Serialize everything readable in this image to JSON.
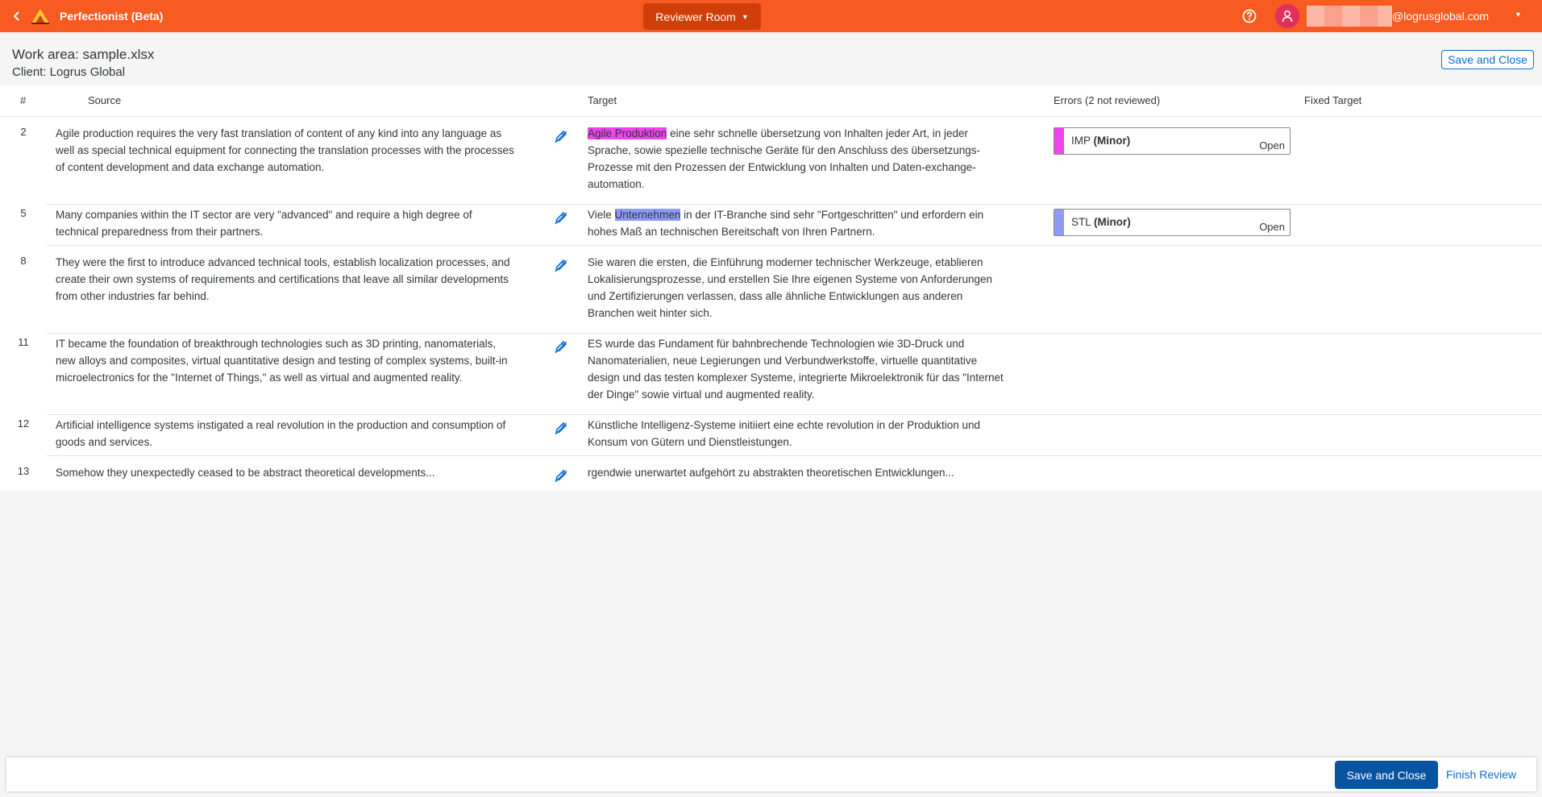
{
  "app": {
    "title": "Perfectionist (Beta)",
    "room_label": "Reviewer Room",
    "user_email": "@logrusglobal.com",
    "brand_color": "#f75b21"
  },
  "icons": {
    "back": "chevron-left-icon",
    "logo": "mountain-logo-icon",
    "help": "help-icon",
    "user": "user-icon",
    "edit": "edit-pen-icon"
  },
  "header": {
    "work_area": "Work area: sample.xlsx",
    "client": "Client: Logrus Global",
    "save_close_label": "Save and Close"
  },
  "table": {
    "columns": {
      "num": "#",
      "source": "Source",
      "target": "Target",
      "errors": "Errors (2 not reviewed)",
      "fixed_target": "Fixed Target"
    },
    "rows": [
      {
        "num": "2",
        "source": "Agile production requires the very fast translation of content of any kind into any language as well as special technical equipment for connecting the translation processes with the processes of content development and data exchange automation.",
        "target_pre": "",
        "target_hl": "Agile Produktion",
        "target_post": " eine sehr schnelle übersetzung von Inhalten jeder Art, in jeder Sprache, sowie spezielle technische Geräte für den Anschluss des übersetzungs-Prozesse mit den Prozessen der Entwicklung von Inhalten und Daten-exchange-automation.",
        "error": {
          "code": "IMP",
          "severity": "(Minor)",
          "status": "Open",
          "color": "#ee43ee"
        }
      },
      {
        "num": "5",
        "source": "Many companies within the IT sector are very \"advanced\" and require a high degree of technical preparedness from their partners.",
        "target_pre": "Viele ",
        "target_hl": "Unternehmen",
        "target_post": " in der IT-Branche sind sehr \"Fortgeschritten\" und erfordern ein hohes Maß an technischen Bereitschaft von Ihren Partnern.",
        "error": {
          "code": "STL",
          "severity": "(Minor)",
          "status": "Open",
          "color": "#8e9bf6"
        }
      },
      {
        "num": "8",
        "source": "They were the first to introduce advanced technical tools, establish localization processes, and create their own systems of requirements and certifications that leave all similar developments from other industries far behind.",
        "target": "Sie waren die ersten, die Einführung moderner technischer Werkzeuge, etablieren Lokalisierungsprozesse, und erstellen Sie Ihre eigenen Systeme von Anforderungen und Zertifizierungen verlassen, dass alle ähnliche Entwicklungen aus anderen Branchen weit hinter sich."
      },
      {
        "num": "11",
        "source": "IT became the foundation of breakthrough technologies such as 3D printing, nanomaterials, new alloys and composites, virtual quantitative design and testing of complex systems, built-in microelectronics for the \"Internet of Things,\" as well as virtual and augmented reality.",
        "target": "ES wurde das Fundament für bahnbrechende Technologien wie 3D-Druck und Nanomaterialien, neue Legierungen und Verbundwerkstoffe, virtuelle quantitative design und das testen komplexer Systeme, integrierte Mikroelektronik für das \"Internet der Dinge\" sowie virtual und augmented reality."
      },
      {
        "num": "12",
        "source": "Artificial intelligence systems instigated a real revolution in the production and consumption of goods and services.",
        "target": "Künstliche Intelligenz-Systeme initiiert eine echte revolution in der Produktion und Konsum von Gütern und Dienstleistungen."
      },
      {
        "num": "13",
        "source": "Somehow they unexpectedly ceased to be abstract theoretical developments...",
        "target": "rgendwie unerwartet aufgehört zu abstrakten theoretischen Entwicklungen..."
      }
    ]
  },
  "footer": {
    "save_close_label": "Save and Close",
    "finish_label": "Finish Review"
  }
}
